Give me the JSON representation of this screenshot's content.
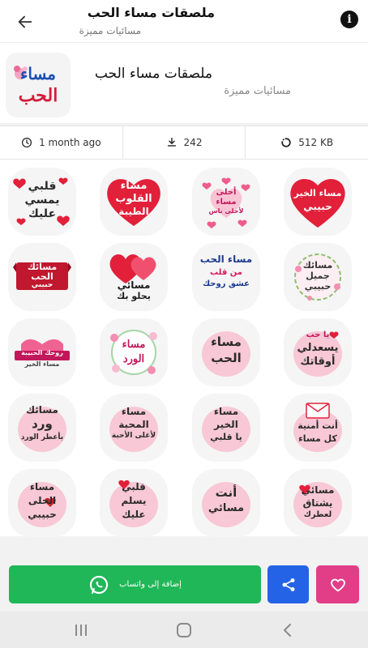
{
  "topbar": {
    "title": "ملصقات مساء الحب",
    "subtitle": "مسائيات مميزة"
  },
  "pack": {
    "title": "ملصقات مساء الحب",
    "publisher": "مسائيات مميزة",
    "thumb_text_1": "مساء",
    "thumb_text_2": "الحب"
  },
  "stats": {
    "age": "1 month ago",
    "downloads": "242",
    "size": "512 KB"
  },
  "stickers": [
    {
      "line1": "قلبي",
      "line2": "يمسي",
      "line3": "عليك"
    },
    {
      "line1": "مساء",
      "line2": "القلوب",
      "line3": "الطيبة"
    },
    {
      "line1": "أحلى",
      "line2": "مساء",
      "line3": "لأحلى ناس"
    },
    {
      "line1": "مساء الخير",
      "line2": "حبيبي",
      "line3": ""
    },
    {
      "line1": "مسائك",
      "line2": "الحب",
      "line3": "حبيبي"
    },
    {
      "line1": "مسائي",
      "line2": "يحلو بك",
      "line3": ""
    },
    {
      "line1": "مساء الحب",
      "line2": "من قلب",
      "line3": "عشق روحك"
    },
    {
      "line1": "مسائك",
      "line2": "جميل",
      "line3": "حبيبي"
    },
    {
      "line1": "روحك الحبيبة",
      "line2": "مساء الخير",
      "line3": ""
    },
    {
      "line1": "مساء",
      "line2": "الورد",
      "line3": ""
    },
    {
      "line1": "مساء",
      "line2": "الحب",
      "line3": ""
    },
    {
      "line1": "يا حب",
      "line2": "يسعدلي",
      "line3": "أوقاتك"
    },
    {
      "line1": "مسائك",
      "line2": "ورد",
      "line3": "بأعطر الورد"
    },
    {
      "line1": "مساء",
      "line2": "المحبة",
      "line3": "لأغلى الأحبة"
    },
    {
      "line1": "مساء",
      "line2": "الخير",
      "line3": "يا قلبي"
    },
    {
      "line1": "أنت أمنية",
      "line2": "كل مساء",
      "line3": ""
    },
    {
      "line1": "مساء",
      "line2": "الحلى",
      "line3": "حبيبي"
    },
    {
      "line1": "قلبي",
      "line2": "يسلم",
      "line3": "عليك"
    },
    {
      "line1": "أنت",
      "line2": "مسائي",
      "line3": ""
    },
    {
      "line1": "مسائي",
      "line2": "يشتاق",
      "line3": "لعطرك"
    }
  ],
  "actions": {
    "add_label": "إضافة إلى واتساب"
  },
  "colors": {
    "whatsapp": "#1fb757",
    "share": "#2563e6",
    "favorite": "#e13e87",
    "sticker_red": "#e2203a",
    "sticker_pink": "#f6c6d3"
  },
  "icons": {
    "back": "arrow-left-icon",
    "info": "info-icon",
    "clock": "clock-icon",
    "download": "download-icon",
    "size": "spinner-icon",
    "whatsapp": "whatsapp-icon",
    "share": "share-icon",
    "favorite": "heart-icon"
  }
}
